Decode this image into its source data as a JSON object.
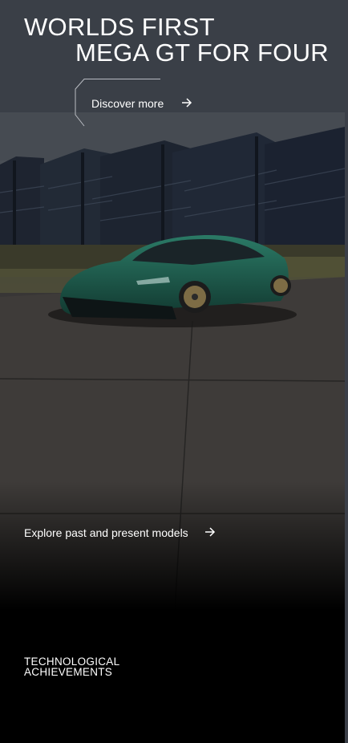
{
  "hero": {
    "title_line1": "WORLDS FIRST",
    "title_line2": "MEGA GT FOR FOUR",
    "cta_label": "Discover more",
    "cta_icon": "arrow-right-icon"
  },
  "explore": {
    "label": "Explore past and present models",
    "icon": "arrow-right-icon"
  },
  "section": {
    "heading_line1": "TECHNOLOGICAL",
    "heading_line2": "ACHIEVEMENTS"
  },
  "colors": {
    "text": "#ffffff",
    "background": "#000000",
    "car_body": "#1e5a4b",
    "wheels": "#8a7a4e"
  }
}
